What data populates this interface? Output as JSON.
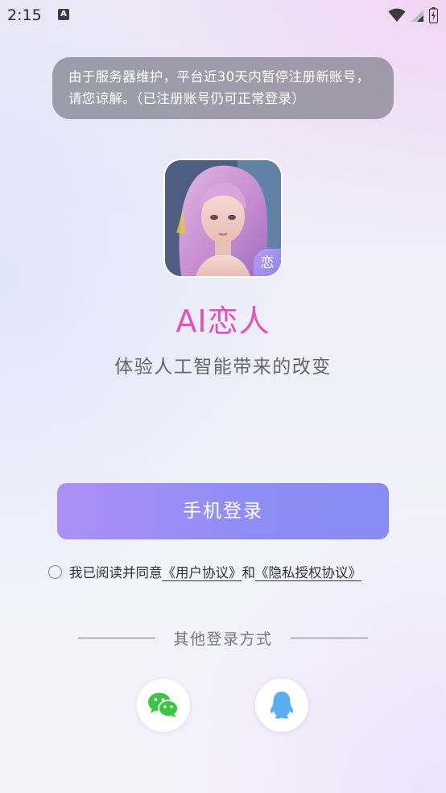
{
  "status_bar": {
    "time": "2:15",
    "notification_icon": "A"
  },
  "notice": {
    "text": "由于服务器维护，平台近30天内暂停注册新账号，请您谅解。（已注册账号仍可正常登录）"
  },
  "app": {
    "icon_badge": "恋",
    "name": "AI恋人",
    "tagline": "体验人工智能带来的改变"
  },
  "login": {
    "phone_button": "手机登录"
  },
  "agreement": {
    "prefix": "我已阅读并同意",
    "user_agreement": "《用户协议》",
    "and": "和",
    "privacy_agreement": "《隐私授权协议》"
  },
  "other_login": {
    "title": "其他登录方式",
    "options": [
      "wechat-icon",
      "qq-icon"
    ]
  },
  "colors": {
    "brand_pink": "#e052b8",
    "button_start": "#ad8ff6",
    "button_end": "#8a8af3",
    "wechat_green": "#3ec545",
    "qq_blue": "#5aaef0"
  }
}
